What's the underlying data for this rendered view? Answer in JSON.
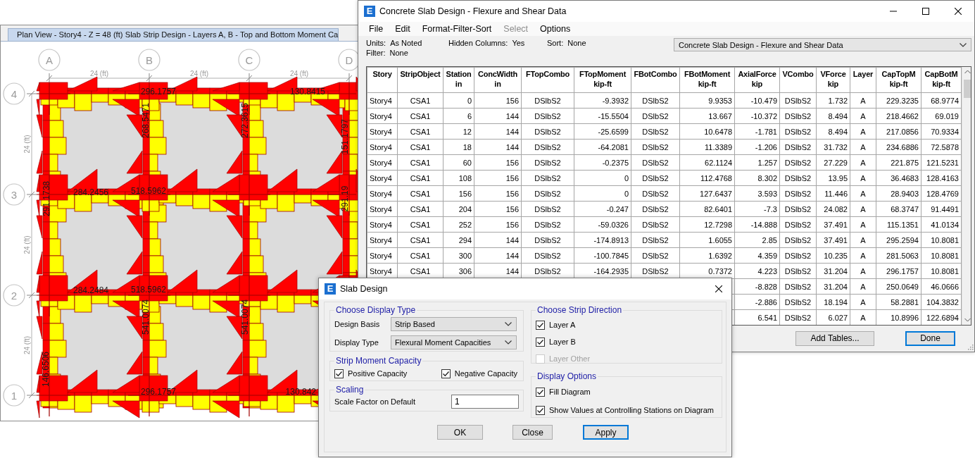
{
  "plan_view": {
    "tab_title": "Plan View - Story4 - Z = 48 (ft)  Slab Strip Design - Layers A, B - Top and Bottom  Moment Ca",
    "column_grid_labels": [
      "A",
      "B",
      "C",
      "D"
    ],
    "row_grid_labels": [
      "4",
      "3",
      "2",
      "1"
    ],
    "column_spacings": [
      "24 (ft)",
      "24 (ft)",
      "24 (ft)"
    ],
    "row_spacings": [
      "24 (ft)",
      "24 (ft)",
      "24 (ft)"
    ],
    "values": [
      "296.1757",
      "130.8415",
      "268.5471",
      "272.3615",
      "151.1797",
      "291.1738",
      "284.2456",
      "518.5962",
      "291.19",
      "284.2484",
      "518.5962",
      "541.0074",
      "541.0074",
      "146.6506",
      "296.1757",
      "130.842"
    ]
  },
  "table_window": {
    "app_icon_letter": "E",
    "title": "Concrete Slab Design - Flexure and Shear Data",
    "menu": [
      {
        "label": "File",
        "disabled": false
      },
      {
        "label": "Edit",
        "disabled": false
      },
      {
        "label": "Format-Filter-Sort",
        "disabled": false
      },
      {
        "label": "Select",
        "disabled": true
      },
      {
        "label": "Options",
        "disabled": false
      }
    ],
    "info": [
      {
        "label": "Units:",
        "value": "As Noted"
      },
      {
        "label": "Hidden Columns:",
        "value": "Yes"
      },
      {
        "label": "Sort:",
        "value": "None"
      },
      {
        "label": "Filter:",
        "value": "None"
      }
    ],
    "table_selector": "Concrete Slab Design - Flexure and Shear Data",
    "columns": [
      {
        "name": "Story"
      },
      {
        "name": "StripObject"
      },
      {
        "name": "Station",
        "unit": "in"
      },
      {
        "name": "ConcWidth",
        "unit": "in"
      },
      {
        "name": "FTopCombo"
      },
      {
        "name": "FTopMoment",
        "unit": "kip-ft"
      },
      {
        "name": "FBotCombo"
      },
      {
        "name": "FBotMoment",
        "unit": "kip-ft"
      },
      {
        "name": "AxialForce",
        "unit": "kip"
      },
      {
        "name": "VCombo"
      },
      {
        "name": "VForce",
        "unit": "kip"
      },
      {
        "name": "Layer"
      },
      {
        "name": "CapTopM",
        "unit": "kip-ft"
      },
      {
        "name": "CapBotM",
        "unit": "kip-ft"
      }
    ],
    "rows": [
      [
        "Story4",
        "CSA1",
        "0",
        "156",
        "DSlbS2",
        "-9.3932",
        "DSlbS2",
        "9.9353",
        "-10.479",
        "DSlbS2",
        "1.732",
        "A",
        "229.3235",
        "68.9774"
      ],
      [
        "Story4",
        "CSA1",
        "6",
        "144",
        "DSlbS2",
        "-15.5504",
        "DSlbS2",
        "13.667",
        "-10.372",
        "DSlbS2",
        "8.494",
        "A",
        "218.4662",
        "69.019"
      ],
      [
        "Story4",
        "CSA1",
        "12",
        "144",
        "DSlbS2",
        "-25.6599",
        "DSlbS2",
        "10.6478",
        "-1.781",
        "DSlbS2",
        "8.494",
        "A",
        "217.0856",
        "70.9334"
      ],
      [
        "Story4",
        "CSA1",
        "18",
        "144",
        "DSlbS2",
        "-64.2081",
        "DSlbS2",
        "11.3389",
        "-1.206",
        "DSlbS2",
        "31.732",
        "A",
        "234.6886",
        "72.5878"
      ],
      [
        "Story4",
        "CSA1",
        "60",
        "156",
        "DSlbS2",
        "-0.2375",
        "DSlbS2",
        "62.1124",
        "1.257",
        "DSlbS2",
        "27.229",
        "A",
        "221.875",
        "121.5231"
      ],
      [
        "Story4",
        "CSA1",
        "108",
        "156",
        "DSlbS2",
        "0",
        "DSlbS2",
        "112.4768",
        "8.302",
        "DSlbS2",
        "13.95",
        "A",
        "36.4683",
        "128.4163"
      ],
      [
        "Story4",
        "CSA1",
        "156",
        "156",
        "DSlbS2",
        "0",
        "DSlbS2",
        "127.6437",
        "3.593",
        "DSlbS2",
        "11.446",
        "A",
        "28.9403",
        "128.4769"
      ],
      [
        "Story4",
        "CSA1",
        "204",
        "156",
        "DSlbS2",
        "-0.247",
        "DSlbS2",
        "82.6401",
        "-7.3",
        "DSlbS2",
        "24.082",
        "A",
        "68.3747",
        "91.4491"
      ],
      [
        "Story4",
        "CSA1",
        "252",
        "156",
        "DSlbS2",
        "-59.0326",
        "DSlbS2",
        "12.7298",
        "-14.888",
        "DSlbS2",
        "37.491",
        "A",
        "115.1351",
        "41.0134"
      ],
      [
        "Story4",
        "CSA1",
        "294",
        "144",
        "DSlbS2",
        "-174.8913",
        "DSlbS2",
        "1.6055",
        "2.85",
        "DSlbS2",
        "37.491",
        "A",
        "295.2594",
        "10.8081"
      ],
      [
        "Story4",
        "CSA1",
        "300",
        "144",
        "DSlbS2",
        "-100.7845",
        "DSlbS2",
        "1.6392",
        "4.359",
        "DSlbS2",
        "10.235",
        "A",
        "281.5063",
        "10.8081"
      ],
      [
        "Story4",
        "CSA1",
        "306",
        "144",
        "DSlbS2",
        "-164.2935",
        "DSlbS2",
        "0.7372",
        "4.223",
        "DSlbS2",
        "31.204",
        "A",
        "296.1757",
        "10.8081"
      ],
      [
        "-8.828",
        "DSlbS2",
        "31.204",
        "A",
        "250.0649",
        "46.0666"
      ],
      [
        "-2.886",
        "DSlbS2",
        "18.194",
        "A",
        "58.2881",
        "104.3832"
      ],
      [
        "6.541",
        "DSlbS2",
        "6.027",
        "A",
        "10.8996",
        "122.6894"
      ]
    ],
    "buttons": [
      {
        "label": "Add Tables...",
        "default": false
      },
      {
        "label": "Done",
        "default": true
      }
    ]
  },
  "slab_design_dialog": {
    "app_icon_letter": "E",
    "title": "Slab Design",
    "display_type": {
      "title": "Choose Display Type",
      "fields": [
        {
          "label": "Design Basis",
          "value": "Strip Based"
        },
        {
          "label": "Display Type",
          "value": "Flexural Moment Capacities"
        }
      ]
    },
    "strip_moment_capacity": {
      "title": "Strip Moment Capacity",
      "options": [
        {
          "label": "Positive Capacity",
          "checked": true
        },
        {
          "label": "Negative Capacity",
          "checked": true
        }
      ]
    },
    "scaling": {
      "title": "Scaling",
      "label": "Scale Factor on Default",
      "value": "1"
    },
    "strip_direction": {
      "title": "Choose Strip Direction",
      "options": [
        {
          "label": "Layer A",
          "checked": true,
          "disabled": false
        },
        {
          "label": "Layer B",
          "checked": true,
          "disabled": false
        },
        {
          "label": "Layer Other",
          "checked": false,
          "disabled": true
        }
      ]
    },
    "display_options": {
      "title": "Display Options",
      "options": [
        {
          "label": "Fill Diagram",
          "checked": true
        },
        {
          "label": "Show Values at Controlling Stations on Diagram",
          "checked": true
        }
      ]
    },
    "buttons": [
      {
        "label": "OK",
        "default": false
      },
      {
        "label": "Close",
        "default": false
      },
      {
        "label": "Apply",
        "default": true
      }
    ]
  }
}
